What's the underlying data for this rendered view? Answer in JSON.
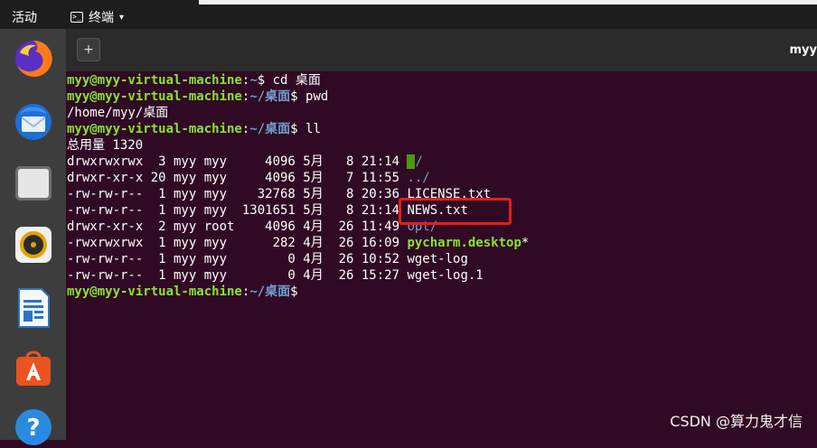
{
  "topbar": {
    "activities": "活动",
    "app_name": "终端",
    "app_caret": "▾"
  },
  "dock": {
    "items": [
      {
        "icon": "firefox-icon"
      },
      {
        "icon": "thunderbird-icon"
      },
      {
        "icon": "files-icon"
      },
      {
        "icon": "rhythmbox-icon"
      },
      {
        "icon": "libreoffice-writer-icon"
      },
      {
        "icon": "ubuntu-software-icon"
      },
      {
        "icon": "help-icon"
      }
    ]
  },
  "window": {
    "new_tab_label": "+",
    "title": "myy"
  },
  "terminal": {
    "user_host": "myy@myy-virtual-machine",
    "colon": ":",
    "home_path": "~",
    "desk_path": "~/桌面",
    "dollar": "$ ",
    "cmd1": "cd 桌面",
    "cmd2": "pwd",
    "pwd_output": "/home/myy/桌面",
    "cmd3": "ll",
    "total": "总用量 1320",
    "entries": [
      {
        "meta": "drwxrwxrwx  3 myy myy     4096 5月   8 21:14 ",
        "name": "./",
        "type": "cwd"
      },
      {
        "meta": "drwxr-xr-x 20 myy myy     4096 5月   7 11:55 ",
        "name": "../",
        "type": "dir"
      },
      {
        "meta": "-rw-rw-r--  1 myy myy    32768 5月   8 20:36 ",
        "name": "LICENSE.txt",
        "type": "file"
      },
      {
        "meta": "-rw-rw-r--  1 myy myy  1301651 5月   8 21:14 ",
        "name": "NEWS.txt",
        "type": "file"
      },
      {
        "meta": "drwxr-xr-x  2 myy root    4096 4月  26 11:49 ",
        "name": "opt/",
        "type": "dir"
      },
      {
        "meta": "-rwxrwxrwx  1 myy myy      282 4月  26 16:09 ",
        "name": "pycharm.desktop",
        "suffix": "*",
        "type": "exe"
      },
      {
        "meta": "-rw-rw-r--  1 myy myy        0 4月  26 10:52 ",
        "name": "wget-log",
        "type": "file"
      },
      {
        "meta": "-rw-rw-r--  1 myy myy        0 4月  26 15:27 ",
        "name": "wget-log.1",
        "type": "file"
      }
    ]
  },
  "watermark": "CSDN @算力鬼才信",
  "colors": {
    "terminal_bg": "#300a24",
    "prompt_user": "#8ae234",
    "prompt_path": "#729fcf",
    "highlight_box": "#e0201c"
  }
}
